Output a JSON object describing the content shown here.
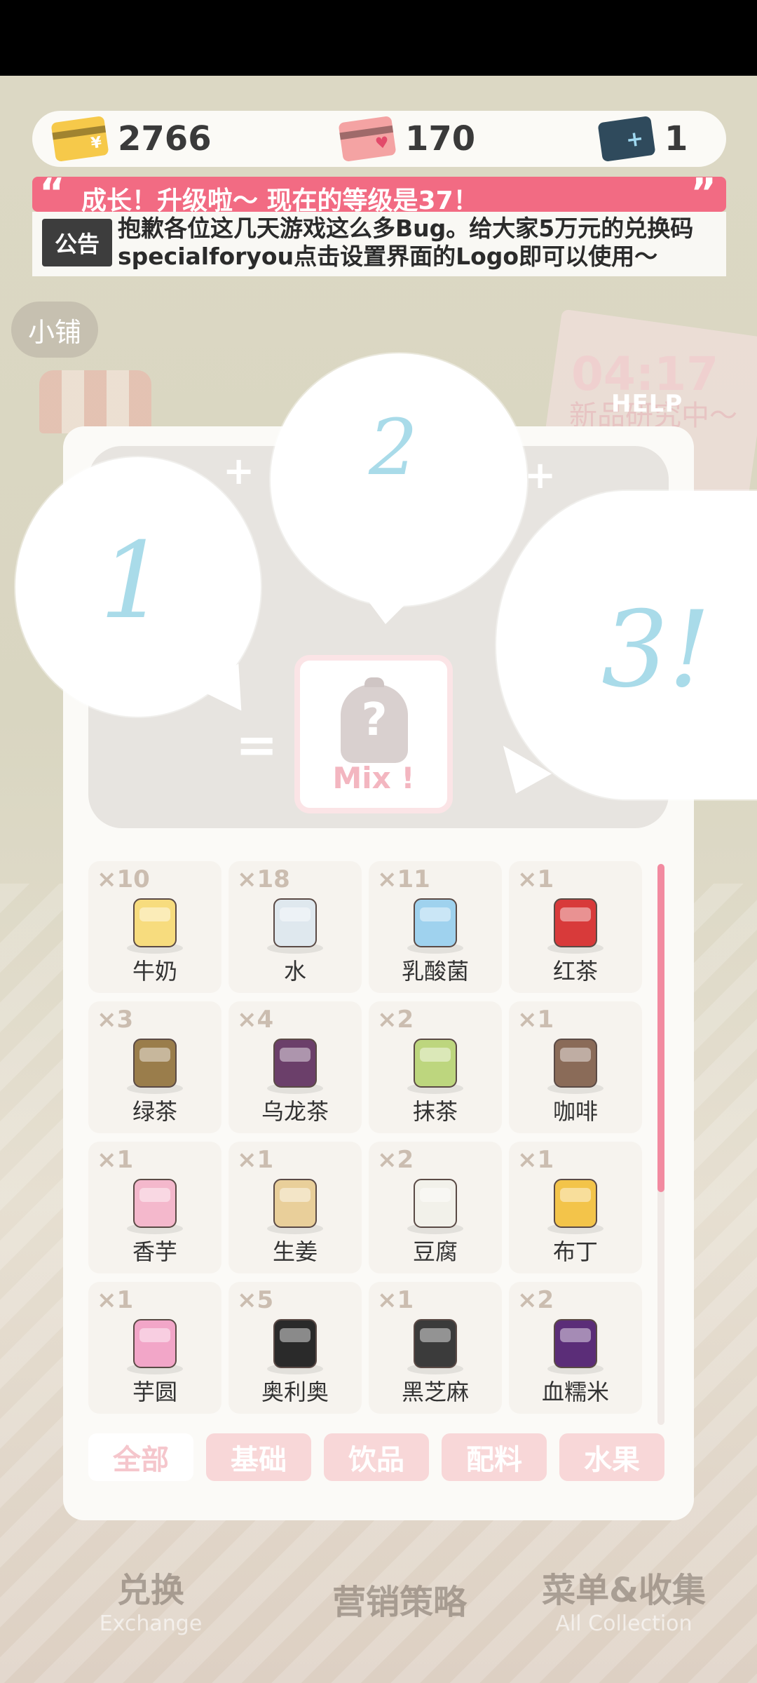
{
  "currencies": [
    {
      "icon": "gold-card-icon",
      "value": "2766"
    },
    {
      "icon": "heart-card-icon",
      "value": "170"
    },
    {
      "icon": "blue-ticket-icon",
      "value": "1"
    }
  ],
  "level_banner": {
    "text": "成长！升级啦〜 现在的等级是37！"
  },
  "notice": {
    "tag": "公告",
    "text": "抱歉各位这几天游戏这么多Bug。给大家5万元的兑换码specialforyou点击设置界面的Logo即可以使用〜"
  },
  "background": {
    "shop_label": "小铺",
    "time": "04:17",
    "time_sub": "新品研究中〜",
    "help": "HELP",
    "nav": [
      {
        "label": "兑换",
        "sub": "Exchange"
      },
      {
        "label": "营销策略",
        "sub": ""
      },
      {
        "label": "菜单&收集",
        "sub": "All Collection"
      }
    ]
  },
  "mix": {
    "slots": [
      "1",
      "2",
      "3!"
    ],
    "button": "Mix !"
  },
  "ingredients": [
    {
      "count": "×10",
      "name": "牛奶",
      "icon": "milk-carton-icon",
      "color": "#f7dc7e"
    },
    {
      "count": "×18",
      "name": "水",
      "icon": "water-glass-icon",
      "color": "#dfe8ee"
    },
    {
      "count": "×11",
      "name": "乳酸菌",
      "icon": "yogurt-drink-icon",
      "color": "#9fd2ee"
    },
    {
      "count": "×1",
      "name": "红茶",
      "icon": "black-tea-icon",
      "color": "#d83a3a"
    },
    {
      "count": "×3",
      "name": "绿茶",
      "icon": "green-tea-icon",
      "color": "#9a7d4b"
    },
    {
      "count": "×4",
      "name": "乌龙茶",
      "icon": "oolong-tea-icon",
      "color": "#6b3f6a"
    },
    {
      "count": "×2",
      "name": "抹茶",
      "icon": "matcha-icon",
      "color": "#bdd67e"
    },
    {
      "count": "×1",
      "name": "咖啡",
      "icon": "coffee-bag-icon",
      "color": "#8a6b58"
    },
    {
      "count": "×1",
      "name": "香芋",
      "icon": "taro-icon",
      "color": "#f4b8cc"
    },
    {
      "count": "×1",
      "name": "生姜",
      "icon": "ginger-icon",
      "color": "#e9cf9a"
    },
    {
      "count": "×2",
      "name": "豆腐",
      "icon": "tofu-icon",
      "color": "#f2f1ea"
    },
    {
      "count": "×1",
      "name": "布丁",
      "icon": "pudding-icon",
      "color": "#f3c44a"
    },
    {
      "count": "×1",
      "name": "芋圆",
      "icon": "taro-ball-icon",
      "color": "#f2a6c8"
    },
    {
      "count": "×5",
      "name": "奥利奥",
      "icon": "oreo-icon",
      "color": "#2a2a2a"
    },
    {
      "count": "×1",
      "name": "黑芝麻",
      "icon": "black-sesame-icon",
      "color": "#3b3b3b"
    },
    {
      "count": "×2",
      "name": "血糯米",
      "icon": "black-rice-icon",
      "color": "#5b2d78"
    }
  ],
  "tabs": [
    {
      "label": "全部",
      "active": true
    },
    {
      "label": "基础",
      "active": false
    },
    {
      "label": "饮品",
      "active": false
    },
    {
      "label": "配料",
      "active": false
    },
    {
      "label": "水果",
      "active": false
    }
  ]
}
